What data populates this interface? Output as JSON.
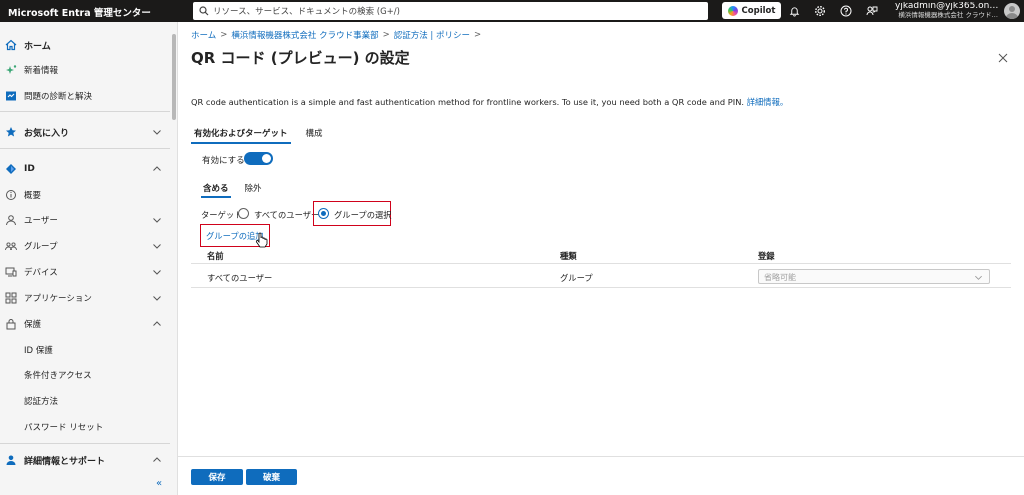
{
  "topbar": {
    "brand": "Microsoft Entra 管理センター",
    "search_placeholder": "リソース、サービス、ドキュメントの検索 (G+/)",
    "copilot_label": "Copilot",
    "user": "yjkadmin@yjk365.on…",
    "tenant": "横浜情報機器株式会社 クラウド…"
  },
  "sidebar": {
    "items": [
      {
        "label": "ホーム",
        "icon": "home-icon"
      },
      {
        "label": "新着情報",
        "icon": "sparkle-icon"
      },
      {
        "label": "問題の診断と解決",
        "icon": "diagnose-icon"
      },
      {
        "label": "お気に入り",
        "icon": "star-icon"
      },
      {
        "label": "ID",
        "icon": "identity-icon"
      },
      {
        "label": "概要",
        "icon": "info-icon"
      },
      {
        "label": "ユーザー",
        "icon": "user-icon"
      },
      {
        "label": "グループ",
        "icon": "group-icon"
      },
      {
        "label": "デバイス",
        "icon": "device-icon"
      },
      {
        "label": "アプリケーション",
        "icon": "apps-icon"
      },
      {
        "label": "保護",
        "icon": "lock-icon"
      },
      {
        "label": "ID 保護"
      },
      {
        "label": "条件付きアクセス"
      },
      {
        "label": "認証方法"
      },
      {
        "label": "パスワード リセット"
      },
      {
        "label": "詳細情報とサポート",
        "icon": "learn-icon"
      }
    ],
    "collapse_label": "«"
  },
  "breadcrumb": [
    "ホーム",
    "横浜情報機器株式会社 クラウド事業部",
    "認証方法 | ポリシー"
  ],
  "breadcrumb_sep": ">",
  "page": {
    "title": "QR コード (プレビュー) の設定",
    "more": "···",
    "description": "QR code authentication is a simple and fast authentication method for frontline workers. To use it, you need both a QR code and PIN. ",
    "description_link": "詳細情報。"
  },
  "tabs": [
    "有効化およびターゲット",
    "構成"
  ],
  "enable": {
    "label": "有効にする",
    "state": "on"
  },
  "subtabs": [
    "含める",
    "除外"
  ],
  "target": {
    "label": "ターゲット",
    "options": [
      "すべてのユーザー",
      "グループの選択"
    ],
    "selected": "グループの選択"
  },
  "add_group_link": "グループの追加",
  "table": {
    "headers": [
      "名前",
      "種類",
      "登録"
    ],
    "rows": [
      {
        "name": "すべてのユーザー",
        "type": "グループ",
        "registration": "省略可能"
      }
    ]
  },
  "footer": {
    "save": "保存",
    "discard": "破棄"
  },
  "colors": {
    "accent": "#0f6cbd",
    "highlight": "#d0021b",
    "topbar": "#1b1a19"
  }
}
